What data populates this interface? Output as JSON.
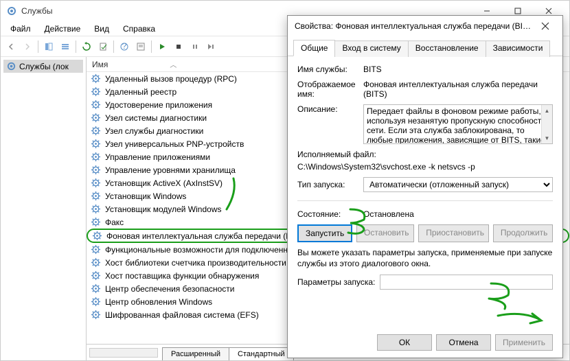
{
  "window": {
    "title": "Службы",
    "menu": [
      "Файл",
      "Действие",
      "Вид",
      "Справка"
    ]
  },
  "left": {
    "label": "Службы (лок"
  },
  "list": {
    "header": "Имя",
    "items": [
      "Удаленный вызов процедур (RPC)",
      "Удаленный реестр",
      "Удостоверение приложения",
      "Узел системы диагностики",
      "Узел службы диагностики",
      "Узел универсальных PNP-устройств",
      "Управление приложениями",
      "Управление уровнями хранилища",
      "Установщик ActiveX (AxInstSV)",
      "Установщик Windows",
      "Установщик модулей Windows",
      "Факс",
      "Фоновая интеллектуальная служба передачи (BITS)",
      "Функциональные возможности для подключенны...",
      "Хост библиотеки счетчика производительности",
      "Хост поставщика функции обнаружения",
      "Центр обеспечения безопасности",
      "Центр обновления Windows",
      "Шифрованная файловая система (EFS)"
    ],
    "highlight_index": 12,
    "bottom_tabs": [
      "Расширенный",
      "Стандартный"
    ]
  },
  "dialog": {
    "title": "Свойства: Фоновая интеллектуальная служба передачи (BITS) (...",
    "tabs": [
      "Общие",
      "Вход в систему",
      "Восстановление",
      "Зависимости"
    ],
    "active_tab": 0,
    "labels": {
      "service_name": "Имя службы:",
      "display_name": "Отображаемое имя:",
      "description": "Описание:",
      "exe": "Исполняемый файл:",
      "startup": "Тип запуска:",
      "state": "Состояние:",
      "params": "Параметры запуска:"
    },
    "values": {
      "service_name": "BITS",
      "display_name": "Фоновая интеллектуальная служба передачи (BITS)",
      "description": "Передает файлы в фоновом режиме работы, используя незанятую пропускную способность сети. Если эта служба заблокирована, то любые приложения, зависящие от BITS, такие",
      "exe": "C:\\Windows\\System32\\svchost.exe -k netsvcs -p",
      "startup": "Автоматически (отложенный запуск)",
      "state": "Остановлена"
    },
    "buttons": {
      "start": "Запустить",
      "stop": "Остановить",
      "pause": "Приостановить",
      "resume": "Продолжить",
      "ok": "ОК",
      "cancel": "Отмена",
      "apply": "Применить"
    },
    "note": "Вы можете указать параметры запуска, применяемые при запуске службы из этого диалогового окна."
  }
}
